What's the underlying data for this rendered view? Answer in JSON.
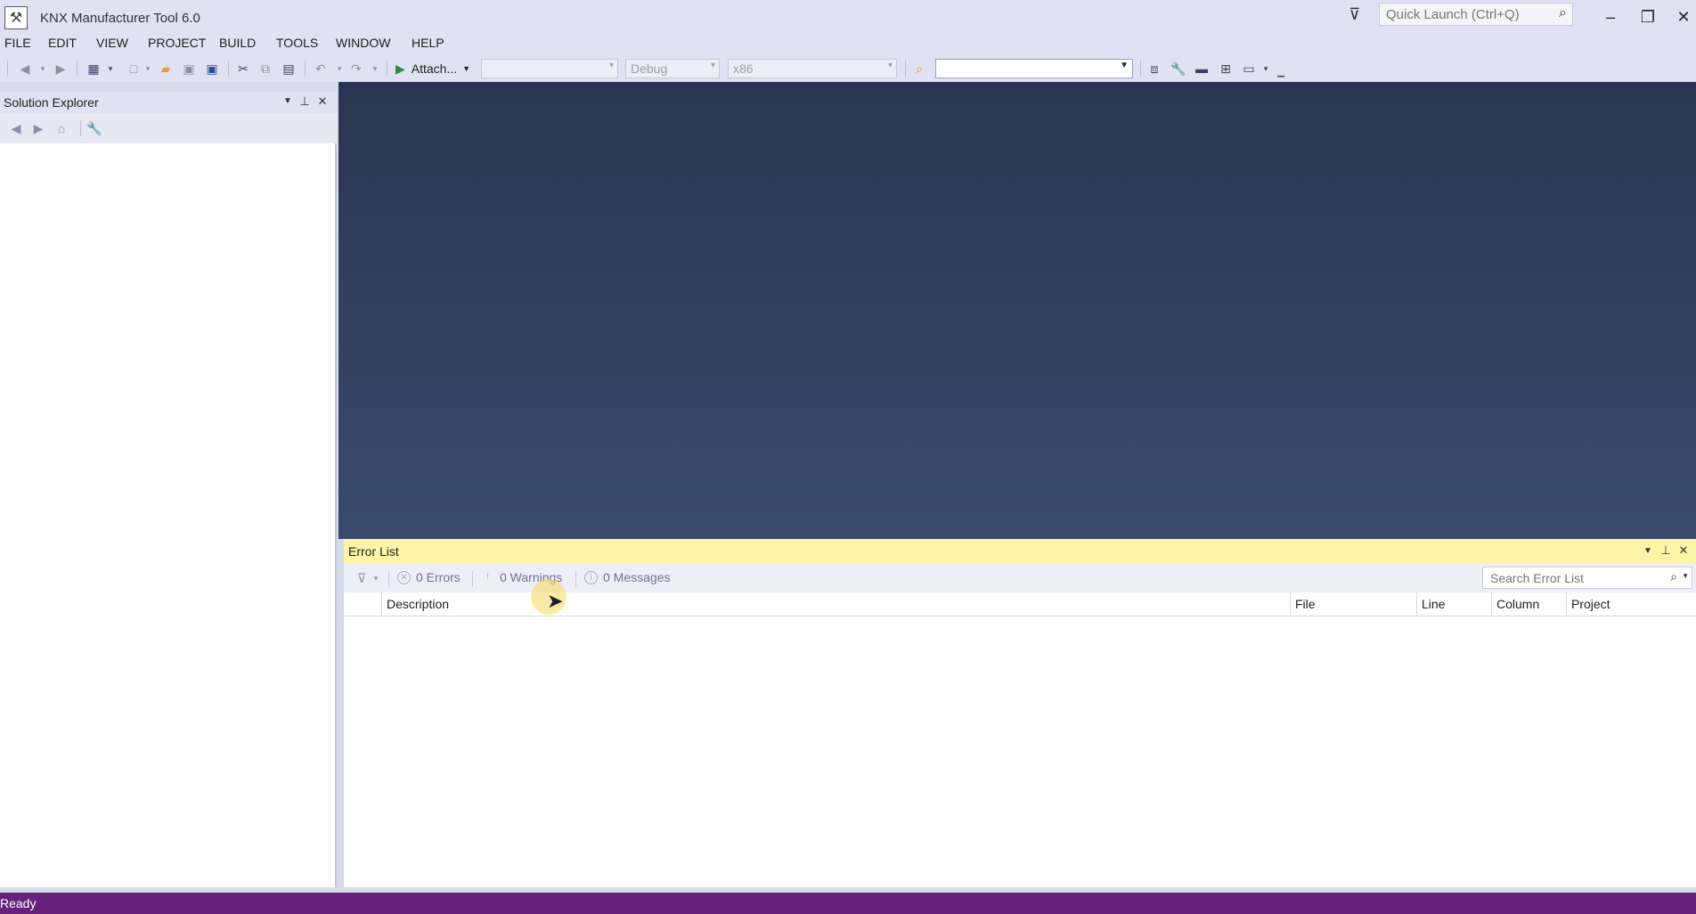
{
  "app": {
    "title": "KNX Manufacturer Tool 6.0",
    "quick_launch_placeholder": "Quick Launch (Ctrl+Q)"
  },
  "menu": [
    "FILE",
    "EDIT",
    "VIEW",
    "PROJECT",
    "BUILD",
    "TOOLS",
    "WINDOW",
    "HELP"
  ],
  "toolbar": {
    "attach_label": "Attach...",
    "config_combo": "Debug",
    "platform_combo": "x86",
    "startup_combo": "",
    "find_combo": ""
  },
  "solution_explorer": {
    "title": "Solution Explorer"
  },
  "error_list": {
    "title": "Error List",
    "errors_label": "0 Errors",
    "warnings_label": "0 Warnings",
    "messages_label": "0 Messages",
    "search_placeholder": "Search Error List",
    "columns": [
      "Description",
      "File",
      "Line",
      "Column",
      "Project"
    ]
  },
  "status": {
    "text": "Ready"
  },
  "colors": {
    "status_bar": "#68217a",
    "error_list_header": "#fdf4a8",
    "document_area": "#2a3452"
  }
}
